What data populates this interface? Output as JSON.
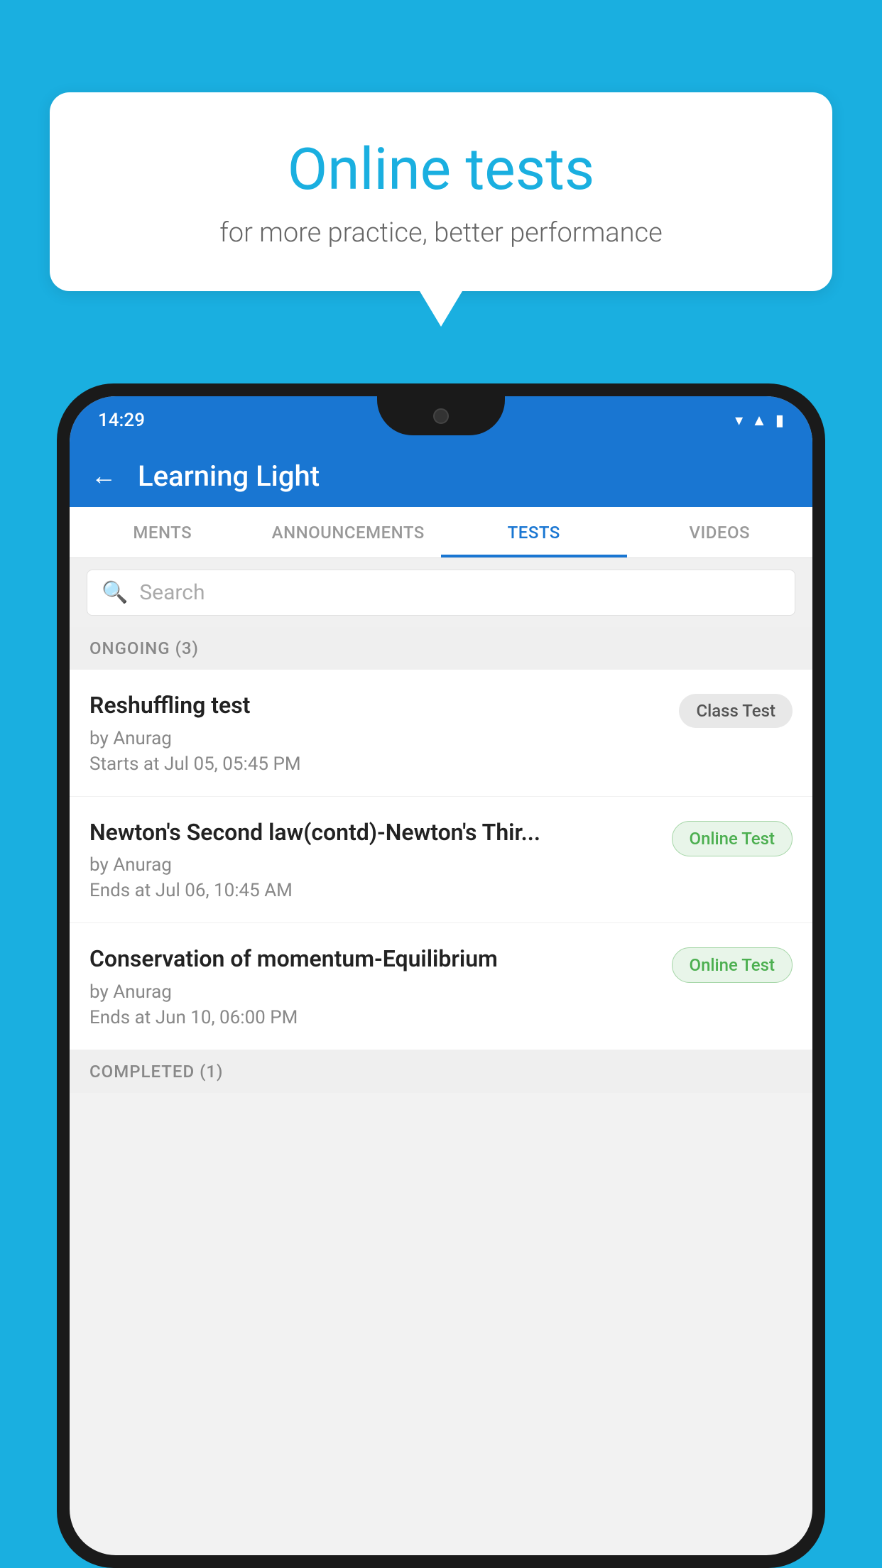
{
  "background_color": "#1AAFE0",
  "bubble": {
    "title": "Online tests",
    "subtitle": "for more practice, better performance"
  },
  "phone": {
    "status_bar": {
      "time": "14:29",
      "icons": [
        "wifi",
        "signal",
        "battery"
      ]
    },
    "app_bar": {
      "title": "Learning Light",
      "back_label": "←"
    },
    "tabs": [
      {
        "label": "MENTS",
        "active": false
      },
      {
        "label": "ANNOUNCEMENTS",
        "active": false
      },
      {
        "label": "TESTS",
        "active": true
      },
      {
        "label": "VIDEOS",
        "active": false
      }
    ],
    "search": {
      "placeholder": "Search"
    },
    "ongoing_section": {
      "label": "ONGOING (3)"
    },
    "tests": [
      {
        "title": "Reshuffling test",
        "author": "by Anurag",
        "date": "Starts at  Jul 05, 05:45 PM",
        "badge": "Class Test",
        "badge_type": "class"
      },
      {
        "title": "Newton's Second law(contd)-Newton's Thir...",
        "author": "by Anurag",
        "date": "Ends at  Jul 06, 10:45 AM",
        "badge": "Online Test",
        "badge_type": "online"
      },
      {
        "title": "Conservation of momentum-Equilibrium",
        "author": "by Anurag",
        "date": "Ends at  Jun 10, 06:00 PM",
        "badge": "Online Test",
        "badge_type": "online"
      }
    ],
    "completed_section": {
      "label": "COMPLETED (1)"
    }
  }
}
